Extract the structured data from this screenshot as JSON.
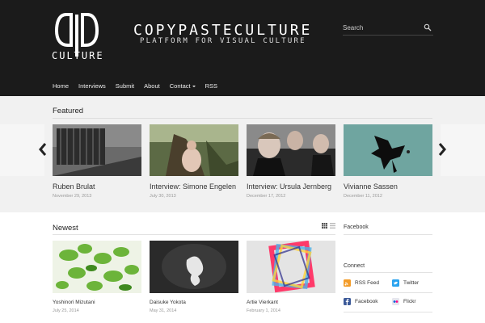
{
  "header": {
    "logo_word": "CULTURE",
    "site_title": "COPYPASTECULTURE",
    "tagline": "PLATFORM FOR VISUAL CULTURE",
    "search_placeholder": "Search"
  },
  "nav": {
    "items": [
      {
        "label": "Home"
      },
      {
        "label": "Interviews"
      },
      {
        "label": "Submit"
      },
      {
        "label": "About"
      },
      {
        "label": "Contact"
      },
      {
        "label": "RSS"
      }
    ]
  },
  "featured": {
    "title": "Featured",
    "items": [
      {
        "title": "Ruben Brulat",
        "date": "November 29, 2013"
      },
      {
        "title": "Interview: Simone Engelen",
        "date": "July 30, 2013"
      },
      {
        "title": "Interview: Ursula Jernberg",
        "date": "December 17, 2012"
      },
      {
        "title": "Vivianne Sassen",
        "date": "December 11, 2012"
      }
    ]
  },
  "newest": {
    "title": "Newest",
    "items": [
      {
        "title": "Yoshinori Mizutani",
        "date": "July 25, 2014"
      },
      {
        "title": "Daisuke Yokota",
        "date": "May 31, 2014"
      },
      {
        "title": "Artie Vierkant",
        "date": "February 1, 2014"
      }
    ]
  },
  "sidebar": {
    "facebook_title": "Facebook",
    "connect_title": "Connect",
    "links": {
      "rss": "RSS Feed",
      "twitter": "Twitter",
      "facebook": "Facebook",
      "flickr": "Flickr"
    }
  },
  "colors": {
    "header_bg": "#1b1b1b",
    "featured_bg": "#f1f1f1",
    "text": "#222222",
    "muted": "#999999"
  }
}
